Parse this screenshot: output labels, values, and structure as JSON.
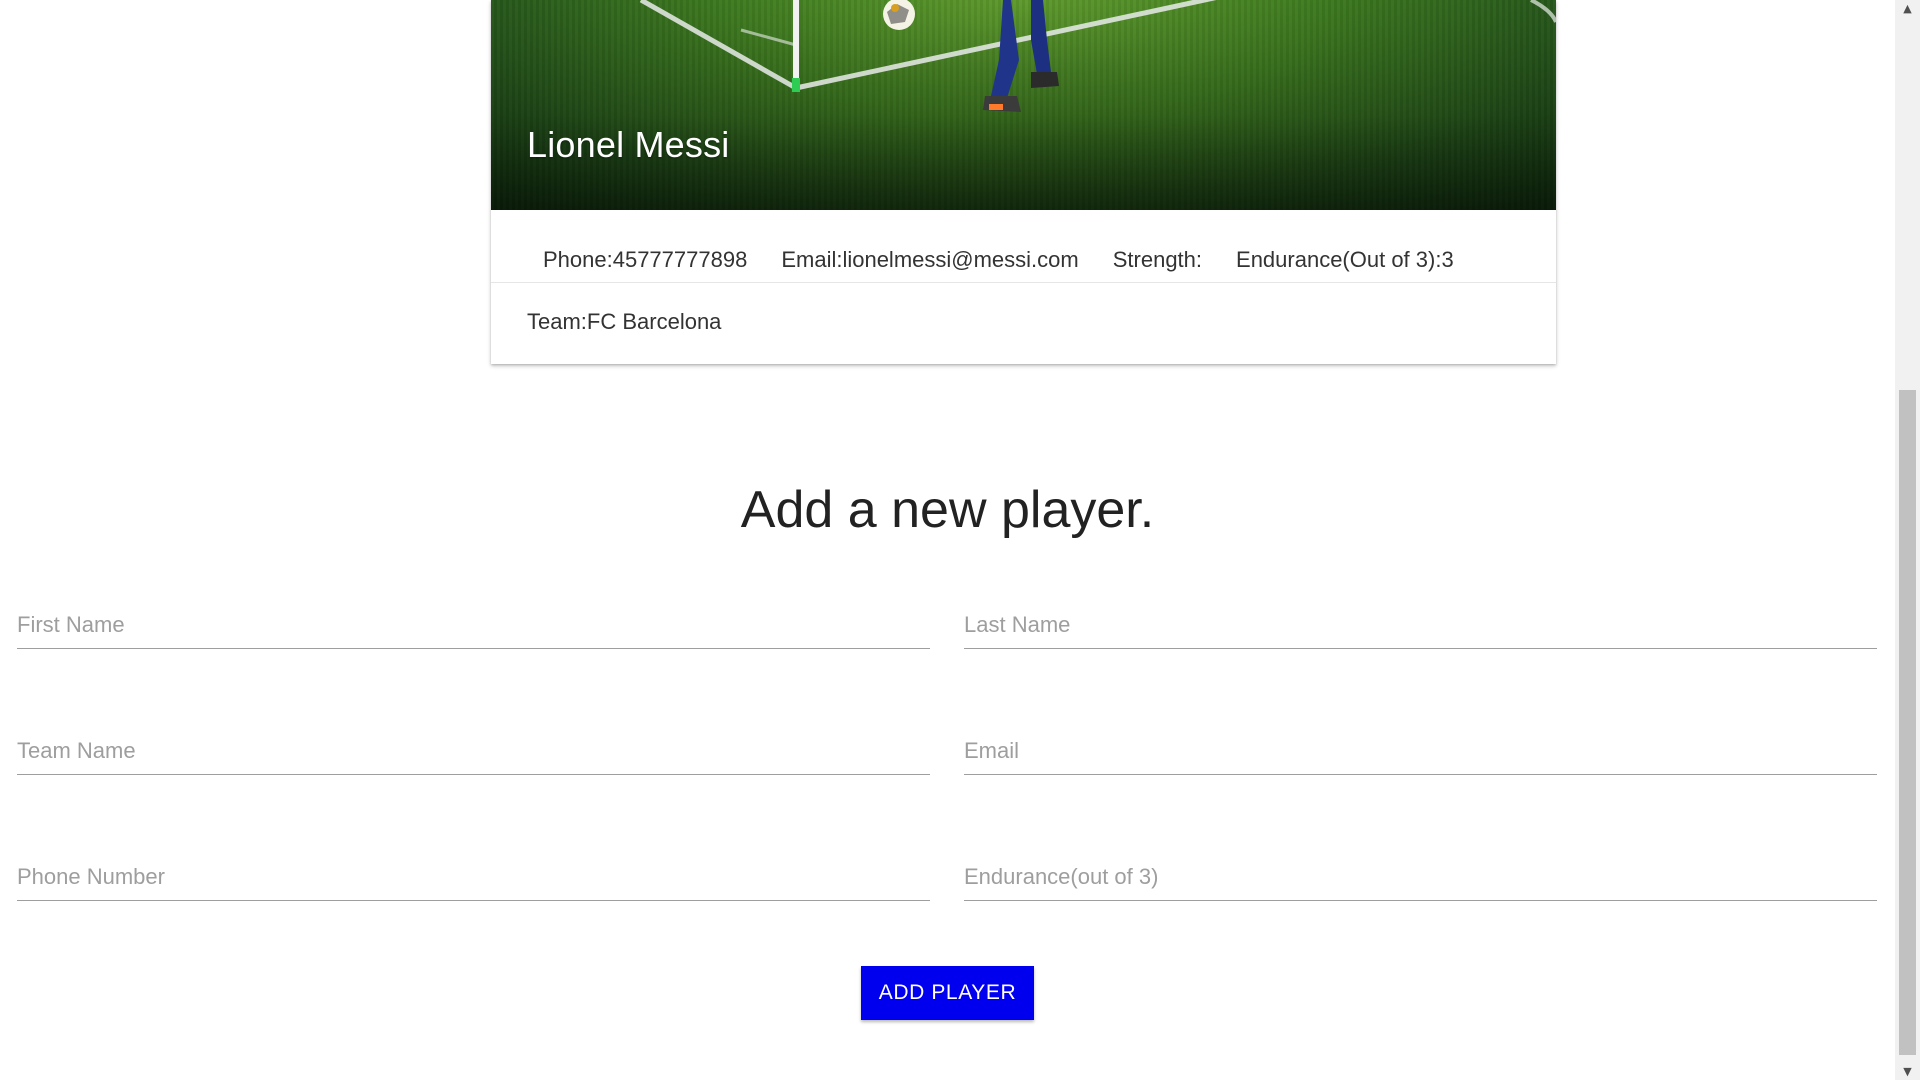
{
  "player_card": {
    "name": "Lionel Messi",
    "phone": "Phone:45777777898",
    "email": "Email:lionelmessi@messi.com",
    "strength": "Strength:",
    "endurance": "Endurance(Out of 3):3",
    "team": "Team:FC Barcelona"
  },
  "form": {
    "title": "Add a new player.",
    "fields": {
      "first_name": {
        "placeholder": "First Name",
        "value": ""
      },
      "last_name": {
        "placeholder": "Last Name",
        "value": ""
      },
      "team_name": {
        "placeholder": "Team Name",
        "value": ""
      },
      "email": {
        "placeholder": "Email",
        "value": ""
      },
      "phone_number": {
        "placeholder": "Phone Number",
        "value": ""
      },
      "endurance": {
        "placeholder": "Endurance(out of 3)",
        "value": ""
      }
    },
    "submit_label": "ADD PLAYER"
  },
  "colors": {
    "button_bg": "#0000ee",
    "field_underline": "#9e9e9e",
    "placeholder": "#9e9e9e"
  },
  "icons": {
    "scroll_up": "▲",
    "scroll_down": "▼"
  }
}
